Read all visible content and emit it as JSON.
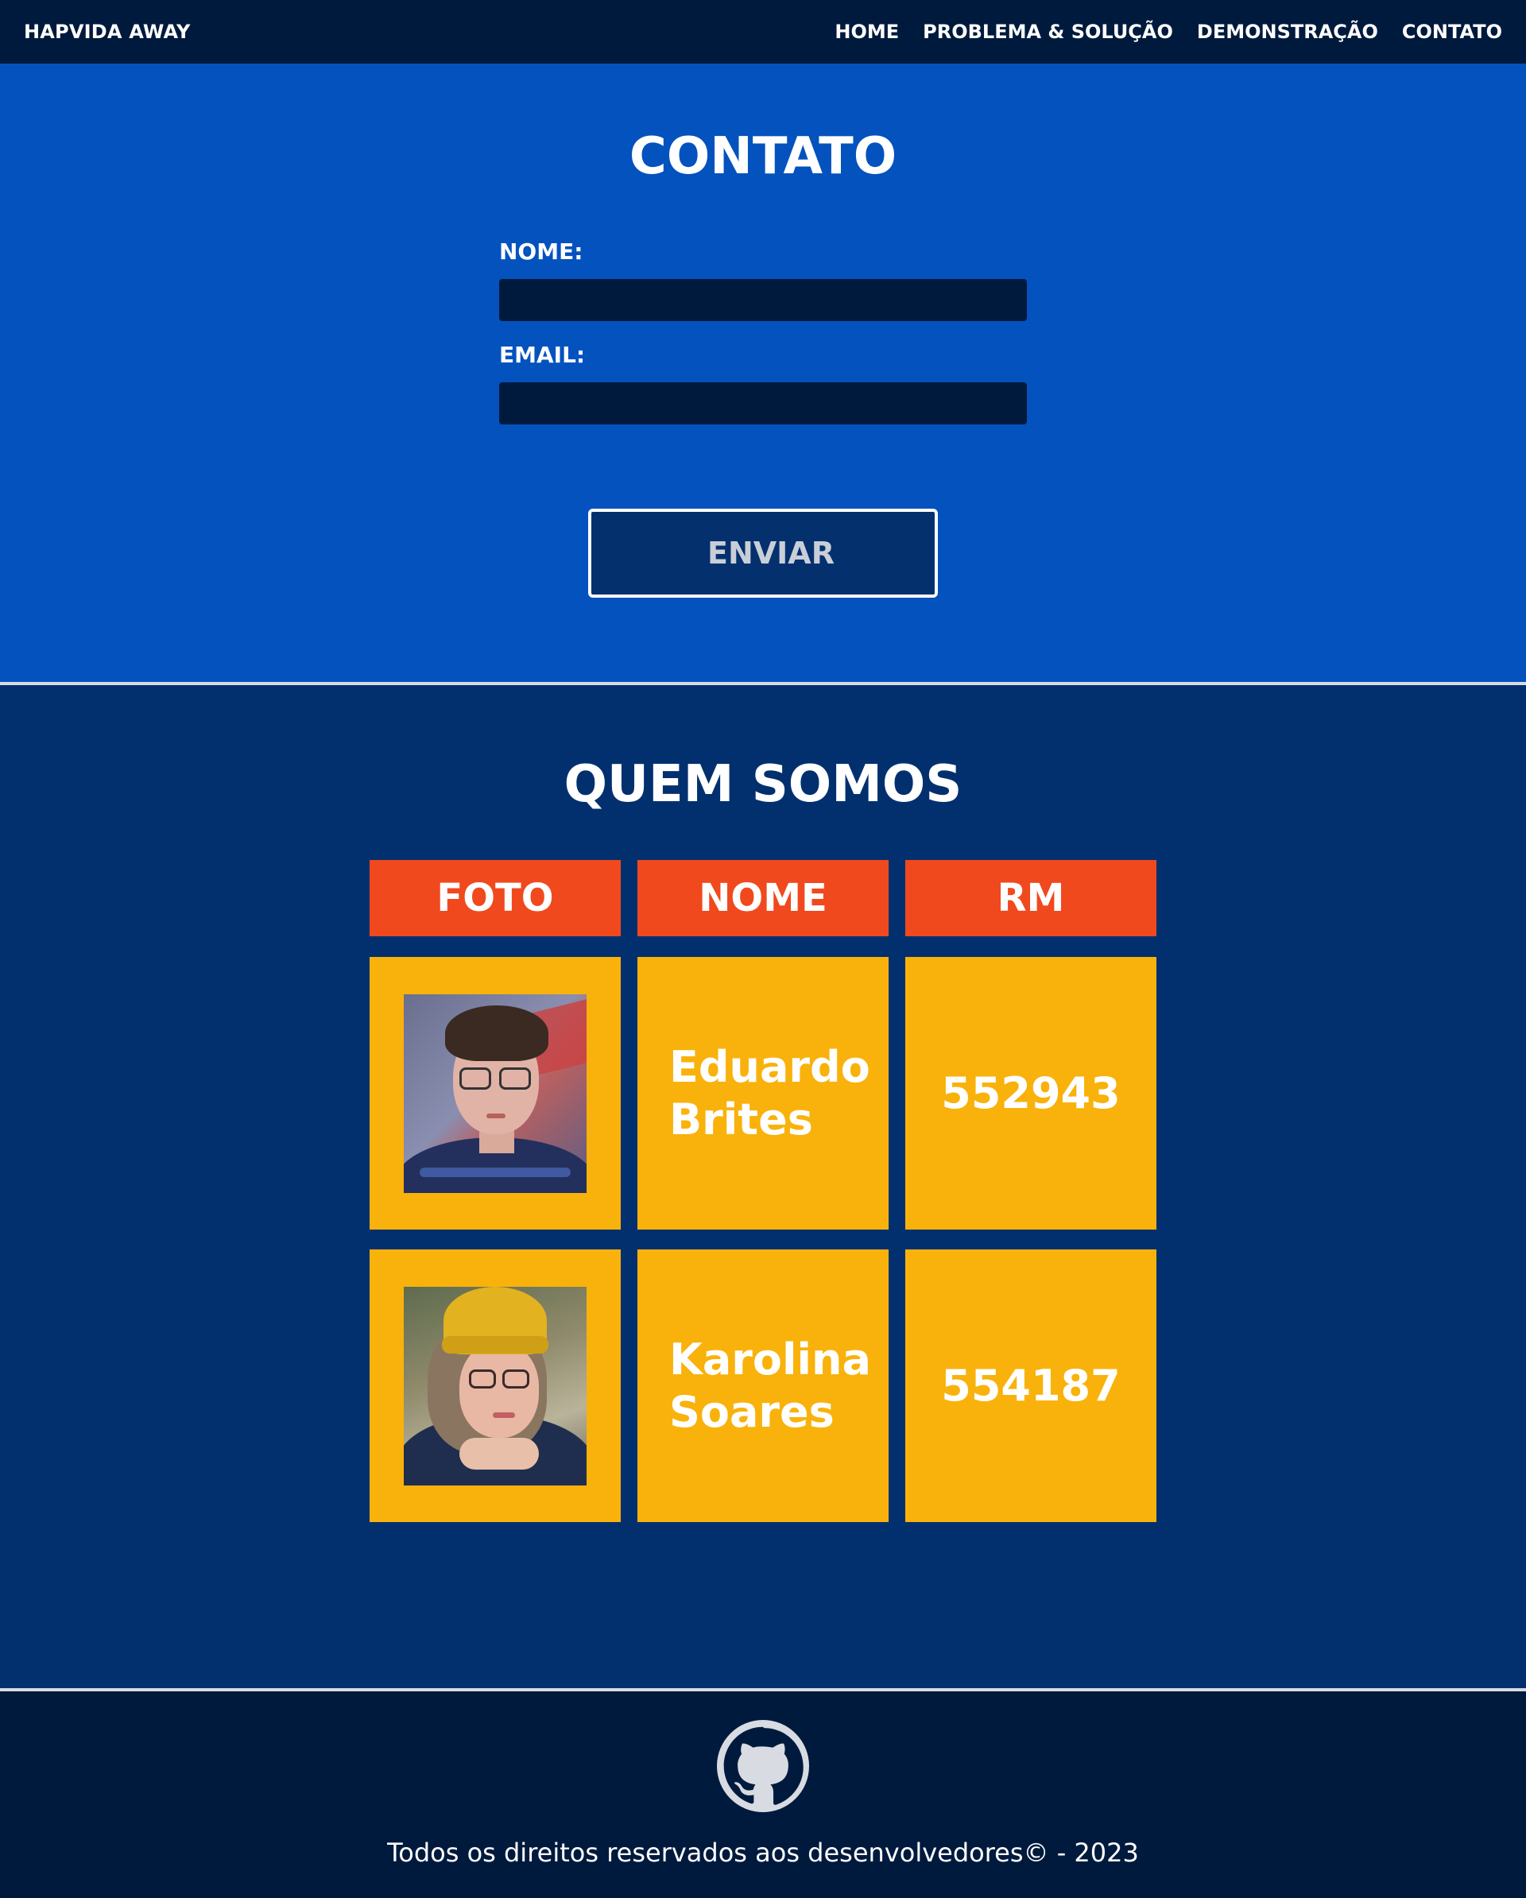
{
  "nav": {
    "brand": "HAPVIDA AWAY",
    "links": [
      "HOME",
      "PROBLEMA & SOLUÇÃO",
      "DEMONSTRAÇÃO",
      "CONTATO"
    ]
  },
  "contact": {
    "title": "CONTATO",
    "name_label": "NOME:",
    "name_value": "",
    "email_label": "EMAIL:",
    "email_value": "",
    "submit_label": "ENVIAR"
  },
  "team": {
    "title": "QUEM SOMOS",
    "headers": [
      "FOTO",
      "NOME",
      "RM"
    ],
    "members": [
      {
        "name_line1": "Eduardo",
        "name_line2": "Brites",
        "rm": "552943",
        "photo": "member-photo-eduardo"
      },
      {
        "name_line1": "Karolina",
        "name_line2": "Soares",
        "rm": "554187",
        "photo": "member-photo-karolina"
      }
    ]
  },
  "footer": {
    "github_icon": "github-icon",
    "copyright": "Todos os direitos reservados aos desenvolvedores© - 2023"
  },
  "colors": {
    "navbar": "#001a3d",
    "contact_bg": "#0452be",
    "team_bg": "#02306f",
    "header_cell": "#f0491e",
    "data_cell": "#f9b20b",
    "footer": "#001a3d"
  }
}
